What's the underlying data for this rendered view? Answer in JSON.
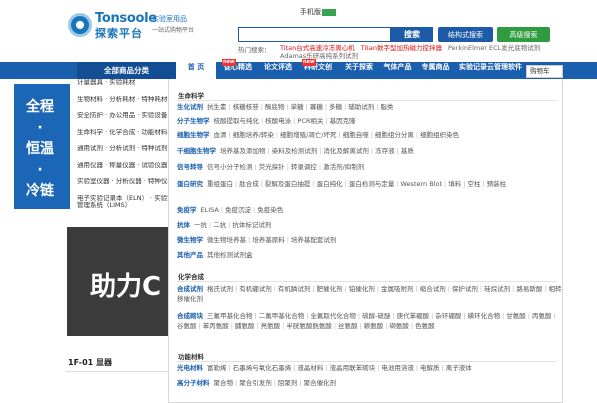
{
  "header": {
    "logo_en": "Tonsoole",
    "logo_cn": "探索平台",
    "slogan_1": "实验室用品",
    "slogan_2": "一站式购物平台",
    "mobile_link": "手机版",
    "search_placeholder": "",
    "search_button": "搜索",
    "structure_search": "结构式搜索",
    "advanced_search": "高级搜索",
    "hot_label": "热门搜索：",
    "hot_terms": [
      {
        "text": "Titan台式高速冷冻离心机",
        "color": "red"
      },
      {
        "text": "Titan数字型加热磁力搅拌器",
        "color": "red"
      },
      {
        "text": "PerkinElmer ECL发光底物试剂",
        "color": "gray"
      },
      {
        "text": "Adamas乐研高纯系列试剂",
        "color": "gray"
      }
    ]
  },
  "nav": {
    "category_label": "全部商品分类",
    "items": [
      {
        "label": "首 页",
        "active": true
      },
      {
        "label": "促心精选",
        "badge": "new"
      },
      {
        "label": "论文评选"
      },
      {
        "label": "科研文创",
        "badge": "new"
      },
      {
        "label": "关于探索"
      },
      {
        "label": "气体产品"
      },
      {
        "label": "专属商品"
      },
      {
        "label": "实验记录云管理软件"
      }
    ],
    "cart": "购物车"
  },
  "banner": {
    "lines": [
      "全程",
      "·",
      "恒温",
      "·",
      "冷链"
    ]
  },
  "left_categories": [
    "计量器具 · 实验耗材",
    "生物材料 · 分析耗材 · 特种耗材",
    "安全防护 · 办公用品 · 实验设备",
    "生命科学 · 化学合成 · 功能材料",
    "通用试剂 · 分析试剂 · 特种试剂",
    "通用仪器 · 称量仪器 · 试验仪器",
    "实验室仪器 · 分析仪器 · 特种仪器",
    "电子实验记录本（ELN） · 实验室管理系统（LIMS）"
  ],
  "hero": {
    "text": "助力C"
  },
  "listing_title": "1F-01 显器",
  "mega_menu": {
    "sections": [
      {
        "title": "生命科学",
        "rows": [
          {
            "head": "生化试剂",
            "items": [
              "抗生素",
              "核糖核苷",
              "酶底物",
              "单糖",
              "寡糖",
              "多糖",
              "辅助试剂",
              "脂类"
            ]
          },
          {
            "head": "分子生物学",
            "items": [
              "核酸提取与纯化",
              "核酸电泳",
              "PCR相关",
              "基因克隆"
            ]
          },
          {
            "head": "细胞生物学",
            "items": [
              "血清",
              "细胞培养/转染",
              "细胞增殖/凋亡/坏死",
              "细胞自噬",
              "细胞组分分离",
              "细胞组织染色"
            ]
          },
          {
            "head": "干细胞生物学",
            "items": [
              "培养基及添加物",
              "染料及检测试剂",
              "消化及解离试剂",
              "冻存液",
              "基质"
            ]
          },
          {
            "head": "信号转导",
            "items": [
              "信号小分子检测",
              "荧光探针",
              "转录调控",
              "激活剂/抑制剂"
            ]
          },
          {
            "head": "蛋白研究",
            "items": [
              "重组蛋白",
              "肽合成",
              "裂解及蛋白抽提",
              "蛋白纯化",
              "蛋白检测与定量",
              "Western Blot",
              "填料",
              "空柱",
              "预装柱"
            ]
          },
          {
            "head": "免疫学",
            "items": [
              "ELISA",
              "免疫沉淀",
              "免疫染色"
            ]
          },
          {
            "head": "抗体",
            "items": [
              "一抗",
              "二抗",
              "抗体标记试剂"
            ]
          },
          {
            "head": "微生物学",
            "items": [
              "微生物培养基",
              "培养基原料",
              "培养基配套试剂"
            ]
          },
          {
            "head": "其他产品",
            "items": [
              "其他检测试剂盒"
            ]
          }
        ]
      },
      {
        "title": "化学合成",
        "rows": [
          {
            "head": "合成试剂",
            "items": [
              "格氏试剂",
              "有机硼试剂",
              "有机膦试剂",
              "肥催化剂",
              "铂催化剂",
              "金属吸附剂",
              "缩合试剂",
              "保护试剂",
              "硅烷试剂",
              "路易斯酸",
              "相转移催化剂"
            ]
          },
          {
            "head": "合成砌块",
            "items": [
              "三氟甲基化合物",
              "二氟甲基化合物",
              "全氟取代化合物",
              "硫醇-硫醚",
              "庚代苯硼酸",
              "杂环硼酸",
              "磺环化合物",
              "甘氨酸",
              "丙氨酸",
              "谷氨酸",
              "苯丙氨酸",
              "脯氨酸",
              "亮氨酸",
              "半胱氨酸胱氨酸",
              "丝氨酸",
              "赖氨酸",
              "缬氨酸",
              "色氨酸"
            ]
          }
        ]
      },
      {
        "title": "功能材料",
        "rows": [
          {
            "head": "光电材料",
            "items": [
              "富勒烯",
              "石墨烯与氧化石墨烯",
              "液晶材料",
              "液晶用联苯砌块",
              "电池用溶液",
              "电解质",
              "离子液体"
            ]
          },
          {
            "head": "高分子材料",
            "items": [
              "聚合物",
              "聚合引发剂",
              "阻聚剂",
              "聚合催化剂"
            ]
          }
        ]
      }
    ]
  }
}
